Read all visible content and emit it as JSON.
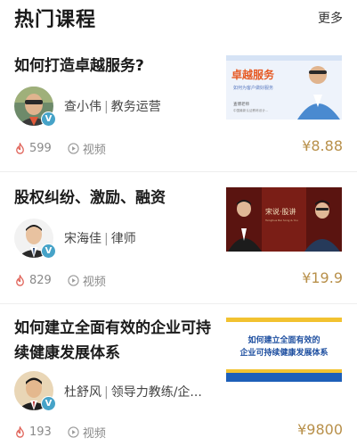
{
  "header": {
    "title": "热门课程",
    "more": "更多"
  },
  "courses": [
    {
      "title": "如何打造卓越服务?",
      "teacher": "查小伟",
      "role": "教务运营",
      "views": "599",
      "media": "视频",
      "price": "¥8.88",
      "thumb": {
        "line1": "卓越服务",
        "line2": "如何为客户做好服务",
        "line3": "查博老师",
        "line4": "中国最新认证教练设计..."
      }
    },
    {
      "title": "股权纠纷、激励、融资",
      "teacher": "宋海佳",
      "role": "律师",
      "views": "829",
      "media": "视频",
      "price": "¥19.9",
      "thumb": {
        "line1": "宋说·股讲",
        "line2": "Tsinghua Bei Song & You"
      }
    },
    {
      "title": "如何建立全面有效的企业可持续健康发展体系",
      "teacher": "杜舒风",
      "role": "领导力教练/企...",
      "views": "193",
      "media": "视频",
      "price": "¥9800",
      "thumb": {
        "line1": "如何建立全面有效的",
        "line2": "企业可持续健康发展体系"
      }
    }
  ],
  "colors": {
    "accent_price": "#b8904a",
    "fire": "#e0645a",
    "badge": "#46a3c8"
  }
}
